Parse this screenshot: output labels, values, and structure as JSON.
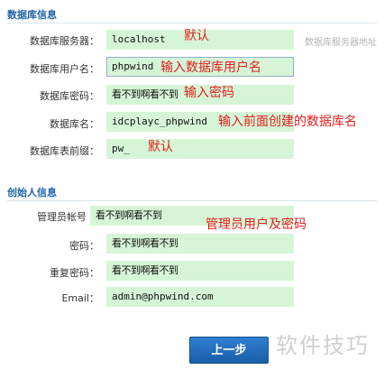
{
  "database_section": {
    "title": "数据库信息",
    "fields": [
      {
        "label": "数据库服务器：",
        "value": "localhost",
        "note": "默认",
        "hint": "数据库服务器地址"
      },
      {
        "label": "数据库用户名：",
        "value": "phpwind",
        "note": "输入数据库用户名"
      },
      {
        "label": "数据库密码：",
        "value": "看不到啊看不到",
        "note": "输入密码"
      },
      {
        "label": "数据库名：",
        "value": "idcplayc_phpwind",
        "note": "输入前面创建的数据库名"
      },
      {
        "label": "数据库表前缀：",
        "value": "pw_",
        "note": "默认"
      }
    ]
  },
  "founder_section": {
    "title": "创始人信息",
    "fields": [
      {
        "label": "管理员帐号",
        "value": "看不到啊看不到"
      },
      {
        "label": "密码：",
        "value": "看不到啊看不到"
      },
      {
        "label": "重复密码：",
        "value": "看不到啊看不到"
      },
      {
        "label": "Email：",
        "value": "admin@phpwind.com"
      }
    ],
    "note": "管理员用户及密码"
  },
  "actions": {
    "next_label": "上一步"
  },
  "watermark": "软件技巧"
}
